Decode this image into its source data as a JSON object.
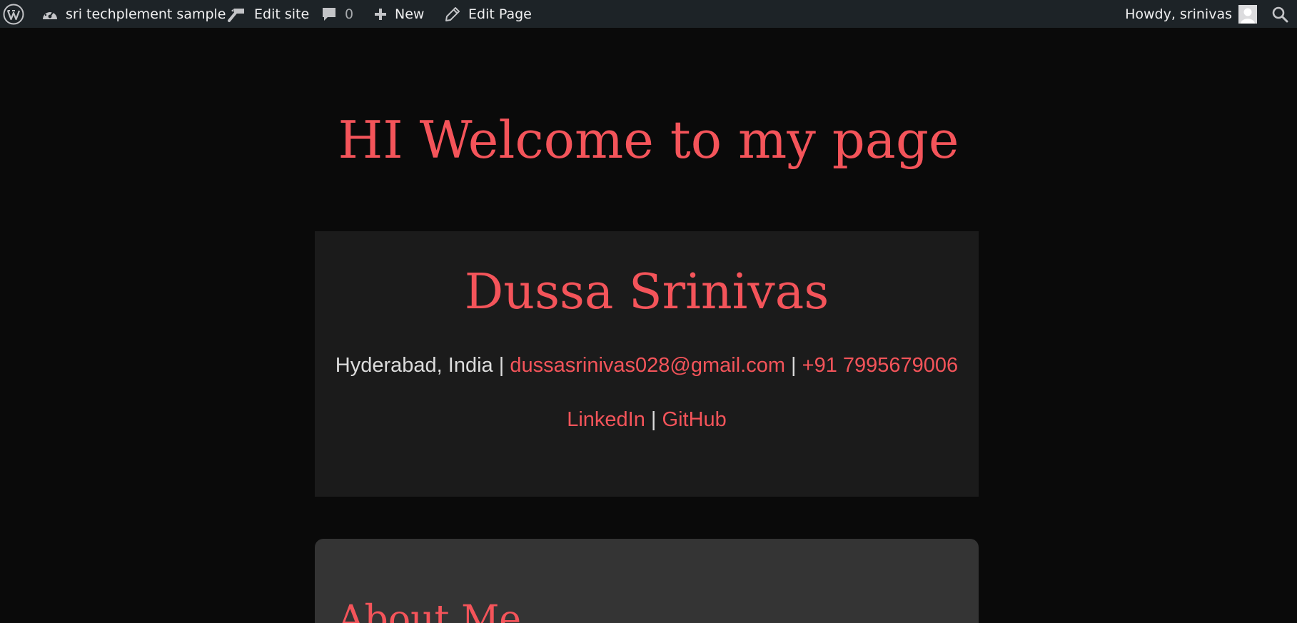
{
  "admin_bar": {
    "wp_logo_icon": "wordpress-logo-icon",
    "site_name": "sri techplement sample",
    "edit_site_label": "Edit site",
    "comments_count": "0",
    "new_label": "New",
    "edit_page_label": "Edit Page",
    "greeting": "Howdy, srinivas",
    "search_icon": "search-icon"
  },
  "page": {
    "title": "HI Welcome to my page"
  },
  "profile": {
    "name": "Dussa Srinivas",
    "location": "Hyderabad, India",
    "separator": "|",
    "email": "dussasrinivas028@gmail.com",
    "phone": "+91 7995679006",
    "linkedin_label": "LinkedIn",
    "github_label": "GitHub"
  },
  "about": {
    "heading": "About Me"
  },
  "colors": {
    "accent": "#f4545a",
    "page_background": "#0a0a0a",
    "card_background": "#1b1b1b",
    "about_card_background": "#343434",
    "admin_bar_background": "#1d2327"
  }
}
